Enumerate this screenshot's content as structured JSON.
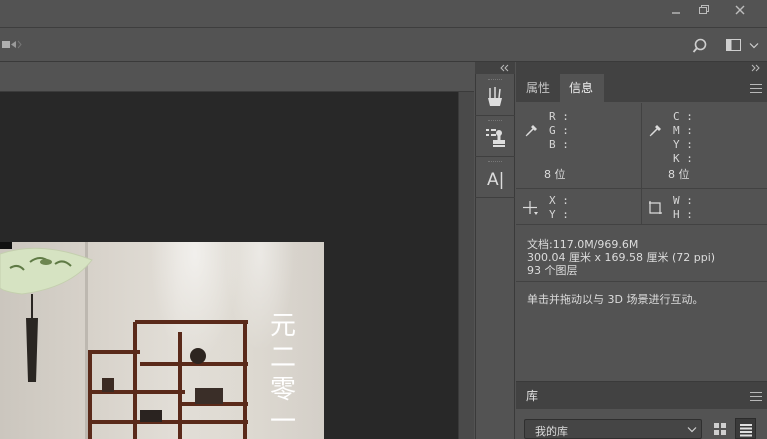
{
  "window": {
    "minimize_glyph": "—",
    "maximize_glyph": "❐",
    "close_glyph": "✕"
  },
  "icons": {
    "video": "video-camera-icon",
    "search": "search-icon",
    "workspace": "workspace-switcher-icon",
    "chevron": "chevron-down-icon",
    "collapse_left": "collapse-left-icon",
    "collapse_right": "collapse-right-icon",
    "brushes": "brush-presets-icon",
    "clone": "clone-source-icon",
    "character": "character-panel-icon",
    "eyedropper": "eyedropper-icon",
    "crosshair": "crosshair-icon",
    "selection": "selection-size-icon",
    "menu": "panel-menu-icon",
    "grid_view": "grid-view-icon",
    "list_view": "list-view-icon"
  },
  "strip": {
    "character_label": "A|"
  },
  "panel": {
    "tabs": [
      {
        "label": "属性",
        "active": false
      },
      {
        "label": "信息",
        "active": true
      }
    ]
  },
  "info": {
    "rgb": {
      "r": "R :",
      "g": "G :",
      "b": "B :",
      "bits": "8 位"
    },
    "cmyk": {
      "c": "C :",
      "m": "M :",
      "y": "Y :",
      "k": "K :",
      "bits": "8 位"
    },
    "xy": {
      "x": "X :",
      "y": "Y :"
    },
    "wh": {
      "w": "W :",
      "h": "H :"
    },
    "doc_size": "文档:117.0M/969.6M",
    "dimensions": "300.04 厘米 x 169.58 厘米 (72 ppi)",
    "layers": "93 个图层",
    "hint": "单击并拖动以与 3D 场景进行互动。"
  },
  "library": {
    "title": "库",
    "selected": "我的库"
  },
  "photo": {
    "calligraphy": [
      "元",
      "二",
      "零",
      "一"
    ]
  },
  "colors": {
    "panel_bg": "#535353",
    "dark_bg": "#424242",
    "canvas_bg": "#282828"
  }
}
